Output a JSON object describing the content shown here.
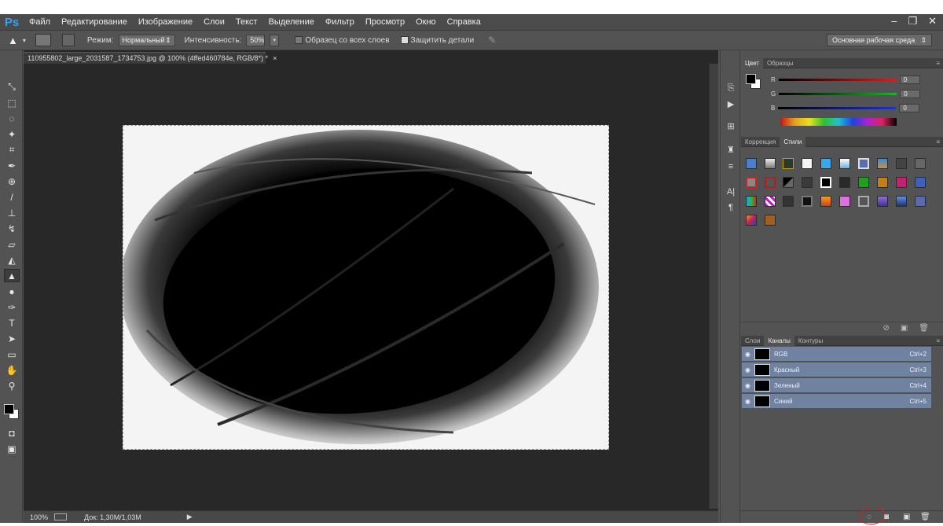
{
  "app": {
    "logo": "Ps"
  },
  "menu": [
    "Файл",
    "Редактирование",
    "Изображение",
    "Слои",
    "Текст",
    "Выделение",
    "Фильтр",
    "Просмотр",
    "Окно",
    "Справка"
  ],
  "window_controls": {
    "minimize": "–",
    "restore": "❐",
    "close": "✕"
  },
  "options": {
    "mode_label": "Режим:",
    "mode_value": "Нормальный",
    "intensity_label": "Интенсивность:",
    "intensity_value": "50%",
    "sample_all_label": "Образец со всех слоев",
    "protect_detail_label": "Защитить детали",
    "sample_all_checked": false,
    "protect_detail_checked": true,
    "workspace": "Основная рабочая среда"
  },
  "document": {
    "tab_title": "110955802_large_2031587_1734753.jpg @ 100% (4ffed460784e, RGB/8*) *",
    "tab_close": "×"
  },
  "status": {
    "zoom": "100%",
    "doc_info": "Док: 1,30M/1,03M"
  },
  "color_panel": {
    "tabs": [
      "Цвет",
      "Образцы"
    ],
    "active_tab": 0,
    "channels": [
      {
        "label": "R",
        "value": "0",
        "color": "#d82020"
      },
      {
        "label": "G",
        "value": "0",
        "color": "#20b030"
      },
      {
        "label": "B",
        "value": "0",
        "color": "#2030d0"
      }
    ]
  },
  "styles_panel": {
    "tabs": [
      "Коррекция",
      "Стили"
    ],
    "active_tab": 1
  },
  "channels_panel": {
    "tabs": [
      "Слои",
      "Каналы",
      "Контуры"
    ],
    "active_tab": 1,
    "rows": [
      {
        "name": "RGB",
        "shortcut": "Ctrl+2"
      },
      {
        "name": "Красный",
        "shortcut": "Ctrl+3"
      },
      {
        "name": "Зеленый",
        "shortcut": "Ctrl+4"
      },
      {
        "name": "Синий",
        "shortcut": "Ctrl+5"
      }
    ]
  },
  "colors": {
    "accent": "#2fa5f6",
    "selection": "#6f83a0",
    "highlight_circle": "#d21d1d"
  }
}
